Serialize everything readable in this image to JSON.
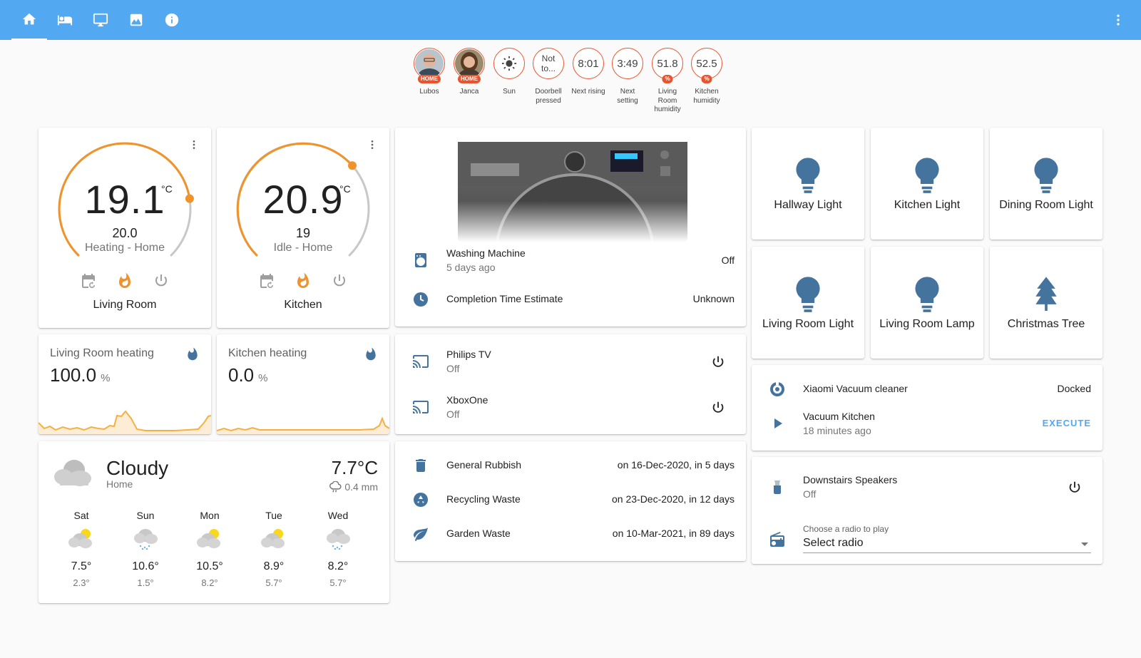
{
  "toolbar": {
    "tabs": [
      "home-icon",
      "bed-icon",
      "monitor-icon",
      "image-icon",
      "info-icon"
    ],
    "menu": "dots-vertical-icon"
  },
  "badges": [
    {
      "label": "Lubos",
      "value": "",
      "tag": "HOME"
    },
    {
      "label": "Janca",
      "value": "",
      "tag": "HOME"
    },
    {
      "label": "Sun",
      "value": "",
      "tag": ""
    },
    {
      "label": "Doorbell pressed",
      "value": "Not to...",
      "tag": ""
    },
    {
      "label": "Next rising",
      "value": "8:01",
      "tag": ""
    },
    {
      "label": "Next setting",
      "value": "3:49",
      "tag": ""
    },
    {
      "label": "Living Room humidity",
      "value": "51.8",
      "tag": "%"
    },
    {
      "label": "Kitchen humidity",
      "value": "52.5",
      "tag": "%"
    }
  ],
  "thermostats": [
    {
      "current": "19.1",
      "unit": "°C",
      "target": "20.0",
      "mode": "Heating - Home",
      "name": "Living Room",
      "arc_progress": 0.8
    },
    {
      "current": "20.9",
      "unit": "°C",
      "target": "19",
      "mode": "Idle - Home",
      "name": "Kitchen",
      "arc_progress": 0.68
    }
  ],
  "sensors": [
    {
      "title": "Living Room heating",
      "value": "100.0",
      "unit": "%"
    },
    {
      "title": "Kitchen heating",
      "value": "0.0",
      "unit": "%"
    }
  ],
  "washer": {
    "rows": [
      {
        "name": "Washing Machine",
        "secondary": "5 days ago",
        "state": "Off"
      },
      {
        "name": "Completion Time Estimate",
        "secondary": "",
        "state": "Unknown"
      }
    ]
  },
  "media": [
    {
      "name": "Philips TV",
      "state": "Off"
    },
    {
      "name": "XboxOne",
      "state": "Off"
    }
  ],
  "waste": [
    {
      "name": "General Rubbish",
      "when": "on 16-Dec-2020, in 5 days"
    },
    {
      "name": "Recycling Waste",
      "when": "on 23-Dec-2020, in 12 days"
    },
    {
      "name": "Garden Waste",
      "when": "on 10-Mar-2021, in 89 days"
    }
  ],
  "lights": [
    {
      "name": "Hallway Light",
      "icon": "lightbulb-icon"
    },
    {
      "name": "Kitchen Light",
      "icon": "lightbulb-icon"
    },
    {
      "name": "Dining Room Light",
      "icon": "lightbulb-icon"
    },
    {
      "name": "Living Room Light",
      "icon": "lightbulb-icon"
    },
    {
      "name": "Living Room Lamp",
      "icon": "lightbulb-icon"
    },
    {
      "name": "Christmas Tree",
      "icon": "pine-tree-icon"
    }
  ],
  "vacuum": {
    "name": "Xiaomi Vacuum cleaner",
    "state": "Docked",
    "script_name": "Vacuum Kitchen",
    "script_time": "18 minutes ago",
    "action": "EXECUTE"
  },
  "speakers": {
    "name": "Downstairs Speakers",
    "state": "Off",
    "select_label": "Choose a radio to play",
    "select_value": "Select radio"
  },
  "weather": {
    "condition": "Cloudy",
    "location": "Home",
    "temperature": "7.7°C",
    "precipitation": "0.4 mm",
    "forecast": [
      {
        "day": "Sat",
        "high": "7.5°",
        "low": "2.3°",
        "icon": "partly-cloudy-icon"
      },
      {
        "day": "Sun",
        "high": "10.6°",
        "low": "1.5°",
        "icon": "rainy-icon"
      },
      {
        "day": "Mon",
        "high": "10.5°",
        "low": "8.2°",
        "icon": "partly-cloudy-icon"
      },
      {
        "day": "Tue",
        "high": "8.9°",
        "low": "5.7°",
        "icon": "partly-cloudy-icon"
      },
      {
        "day": "Wed",
        "high": "8.2°",
        "low": "5.7°",
        "icon": "rainy-icon"
      }
    ]
  },
  "colors": {
    "header": "#53a8f2",
    "accent_orange": "#e9542e",
    "heating": "#f0932b",
    "icon_blue": "#44739e"
  }
}
